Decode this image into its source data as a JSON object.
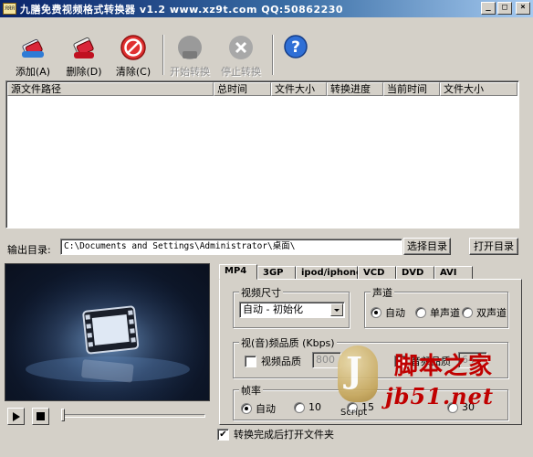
{
  "window": {
    "title": "九膳免费视频格式转换器 v1.2   www.xz9t.com QQ:50862230",
    "app_icon_text": "ЯЯЯ"
  },
  "toolbar": {
    "add": "添加(A)",
    "delete": "删除(D)",
    "clear": "清除(C)",
    "start": "开始转换",
    "stop": "停止转换"
  },
  "file_list": {
    "columns": [
      "源文件路径",
      "总时间",
      "文件大小",
      "转换进度",
      "当前时间",
      "文件大小"
    ],
    "rows": []
  },
  "output": {
    "label": "输出目录:",
    "path": "C:\\Documents and Settings\\Administrator\\桌面\\",
    "browse_button": "选择目录",
    "open_button": "打开目录"
  },
  "tabs": [
    "MP4",
    "3GP",
    "ipod/iphone",
    "VCD",
    "DVD",
    "AVI"
  ],
  "active_tab": "MP4",
  "video_size": {
    "title": "视频尺寸",
    "selected": "自动 - 初始化"
  },
  "channel": {
    "title": "声道",
    "options": [
      "自动",
      "单声道",
      "双声道"
    ],
    "selected": "自动"
  },
  "quality": {
    "title": "视(音)频品质 (Kbps)",
    "video_label": "视频品质",
    "video_value": "800",
    "video_checked": false,
    "audio_label": "音频品质",
    "audio_value": "64",
    "audio_checked": false
  },
  "framerate": {
    "title": "帧率",
    "options": [
      "自动",
      "10",
      "15",
      "30"
    ],
    "selected": "自动"
  },
  "open_after": {
    "label": "转换完成后打开文件夹",
    "checked": true,
    "check_mark": "✔"
  },
  "watermark": {
    "letter": "J",
    "script": "Script",
    "brand": "脚本之家",
    "url": "jb51.net"
  },
  "colors": {
    "face": "#d4d0c8",
    "title_start": "#0a246a",
    "title_end": "#a6caf0",
    "watermark_red": "#c00000"
  }
}
